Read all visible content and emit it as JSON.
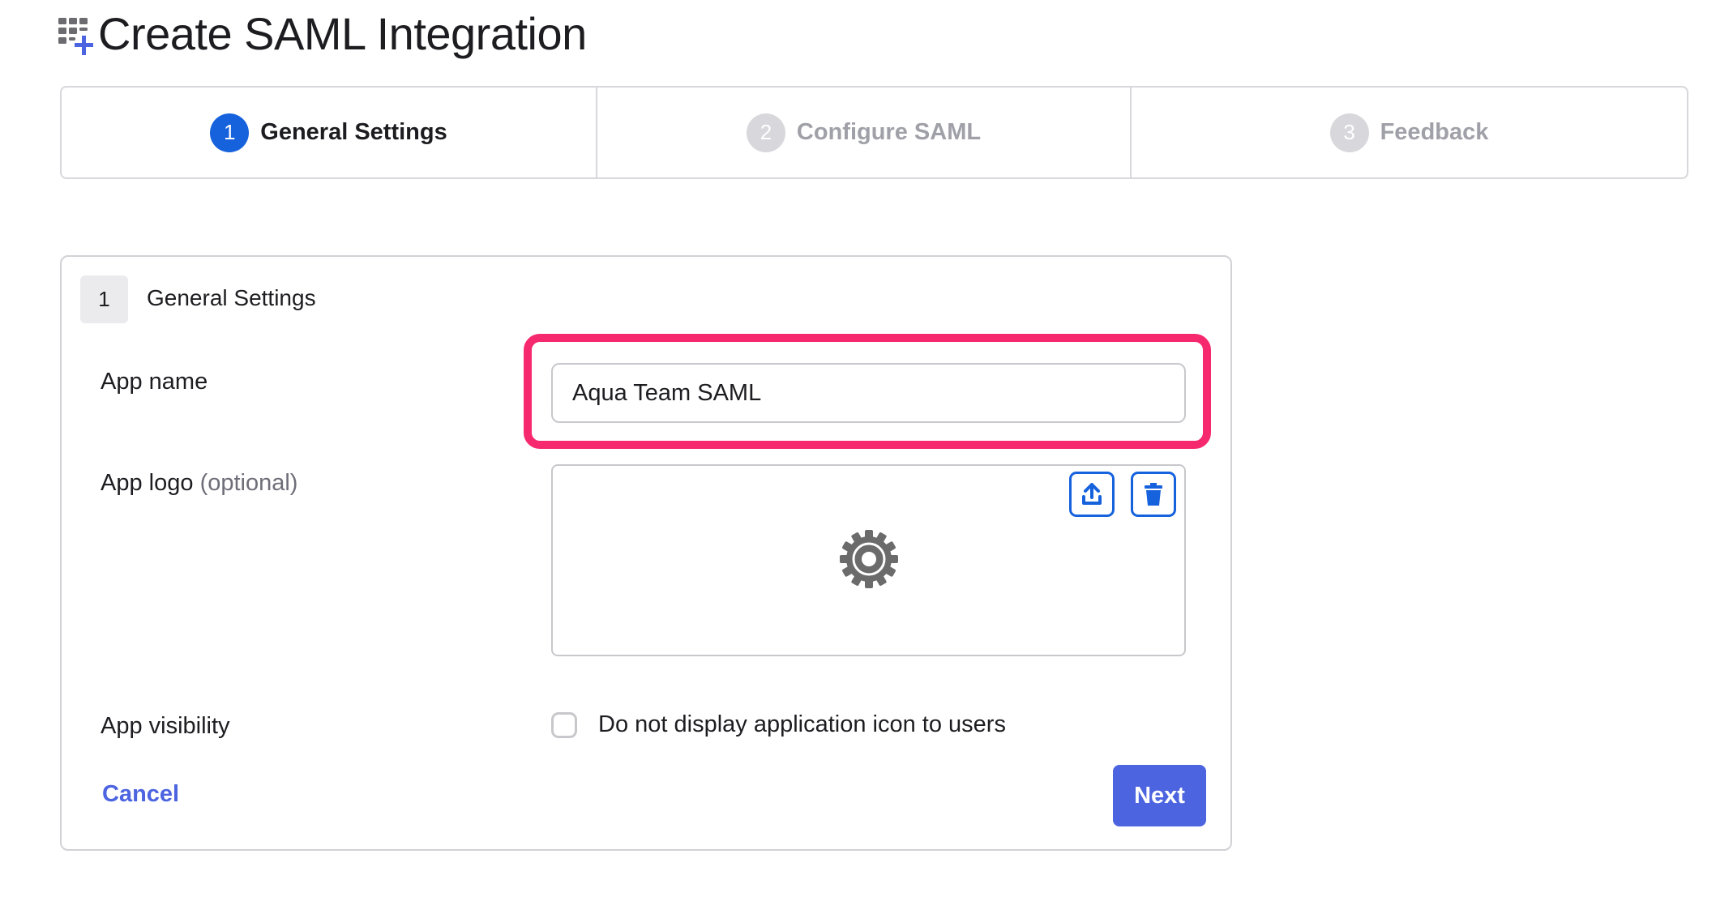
{
  "page": {
    "title": "Create SAML Integration",
    "title_icon": "app-grid-add-icon"
  },
  "stepper": {
    "steps": [
      {
        "number": "1",
        "label": "General Settings",
        "state": "active"
      },
      {
        "number": "2",
        "label": "Configure SAML",
        "state": "inactive"
      },
      {
        "number": "3",
        "label": "Feedback",
        "state": "inactive"
      }
    ]
  },
  "card": {
    "step_number": "1",
    "title": "General Settings",
    "fields": {
      "app_name": {
        "label": "App name",
        "value": "Aqua Team SAML"
      },
      "app_logo": {
        "label": "App logo",
        "optional_text": "(optional)",
        "placeholder_icon": "gear-icon",
        "upload_icon": "upload-icon",
        "delete_icon": "trash-icon"
      },
      "app_visibility": {
        "label": "App visibility",
        "checkbox_label": "Do not display application icon to users",
        "checked": false
      }
    },
    "actions": {
      "cancel_label": "Cancel",
      "next_label": "Next"
    }
  },
  "colors": {
    "primary_blue": "#1662dd",
    "button_indigo": "#4c64e0",
    "highlight_pink": "#f7296e",
    "inactive_gray": "#d7d7dc"
  }
}
